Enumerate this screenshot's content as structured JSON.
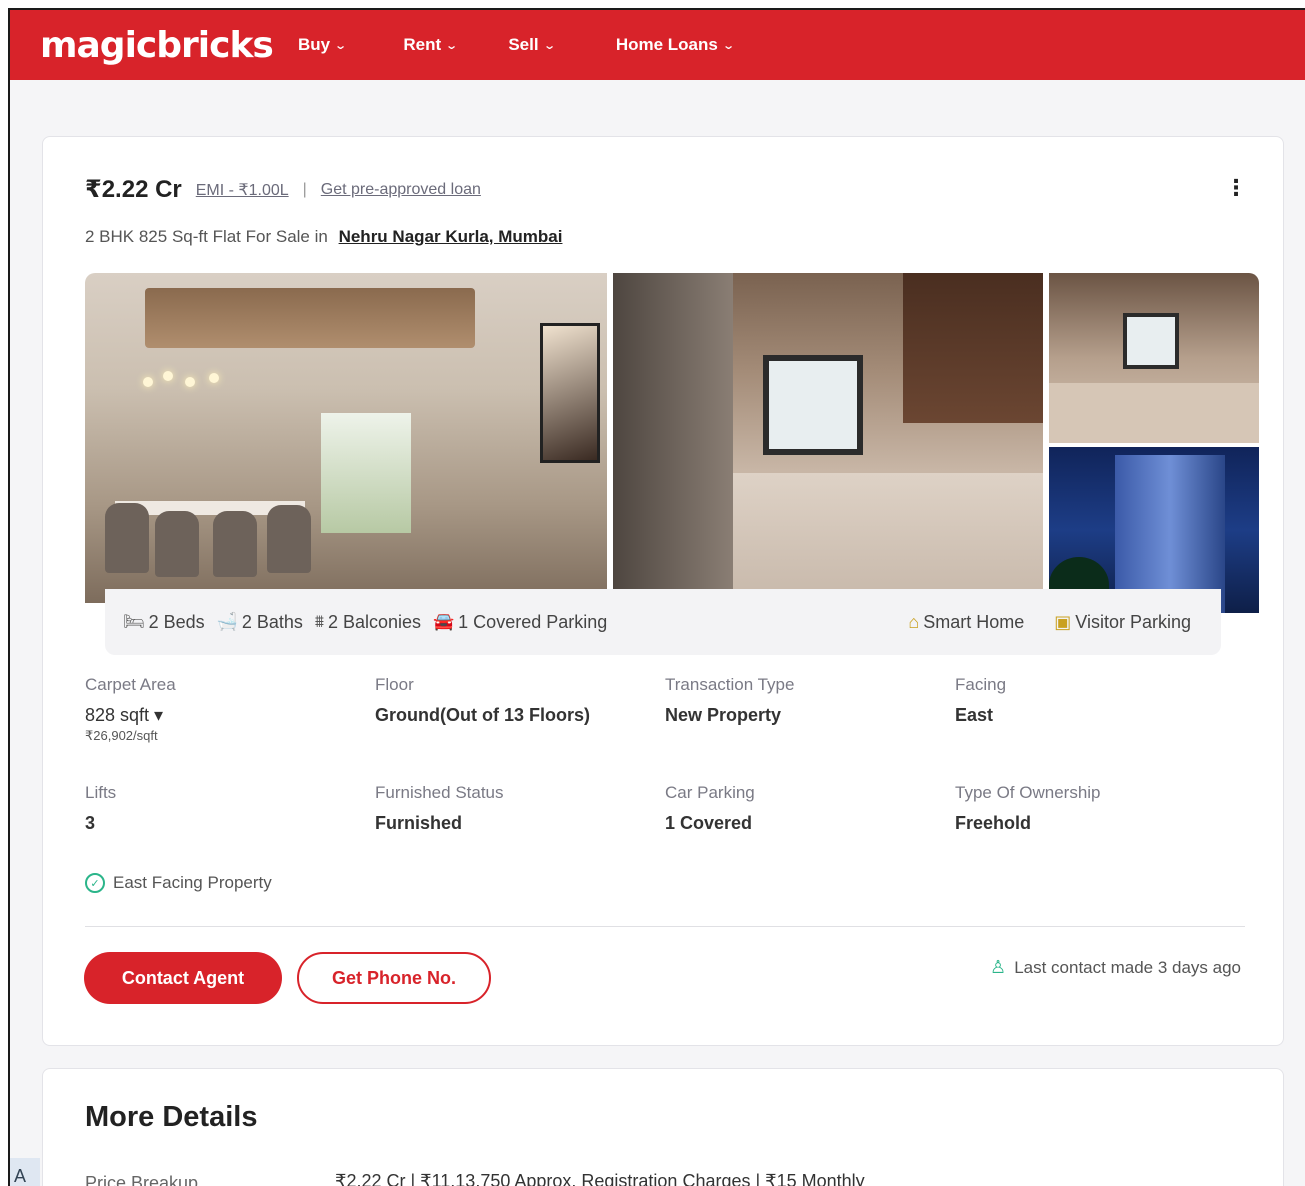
{
  "header": {
    "logo": "magicbricks",
    "nav": [
      {
        "label": "Buy"
      },
      {
        "label": "Rent"
      },
      {
        "label": "Sell"
      },
      {
        "label": "Home Loans"
      }
    ],
    "brand_color": "#d8232a"
  },
  "listing": {
    "price": "₹2.22 Cr",
    "emi": "EMI - ₹1.00L",
    "separator": "|",
    "loan_link": "Get pre-approved loan",
    "subtitle_prefix": "2 BHK 825 Sq-ft Flat For Sale in",
    "locality": "Nehru Nagar Kurla, Mumbai",
    "more_icon": "⋮",
    "amenities": [
      {
        "icon": "bed-icon",
        "label": "2 Beds"
      },
      {
        "icon": "bath-icon",
        "label": "2 Baths"
      },
      {
        "icon": "balcony-icon",
        "label": "2 Balconies"
      },
      {
        "icon": "car-icon",
        "label": "1 Covered Parking"
      }
    ],
    "highlights": [
      {
        "icon": "smart-home-icon",
        "label": "Smart Home"
      },
      {
        "icon": "visitor-parking-icon",
        "label": "Visitor Parking"
      }
    ],
    "specs": [
      {
        "label": "Carpet Area",
        "value": "828 sqft ▾",
        "sub": "₹26,902/sqft"
      },
      {
        "label": "Floor",
        "value": "Ground(Out of 13 Floors)"
      },
      {
        "label": "Transaction Type",
        "value": "New Property"
      },
      {
        "label": "Facing",
        "value": "East"
      },
      {
        "label": "Lifts",
        "value": "3"
      },
      {
        "label": "Furnished Status",
        "value": "Furnished"
      },
      {
        "label": "Car Parking",
        "value": "1 Covered"
      },
      {
        "label": "Type Of Ownership",
        "value": "Freehold"
      }
    ],
    "facing_tag": "East Facing Property",
    "contact_button": "Contact Agent",
    "phone_button": "Get Phone No.",
    "last_contact": "Last contact made 3 days ago"
  },
  "more_details": {
    "title": "More Details",
    "price_breakup_label": "Price Breakup",
    "price_breakup_value": "₹2.22 Cr | ₹11,13,750 Approx. Registration Charges | ₹15 Monthly"
  },
  "corner_label": "A"
}
